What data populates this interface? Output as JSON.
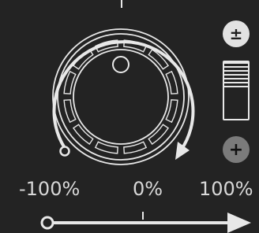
{
  "knob": {
    "value_percent": 0
  },
  "range_labels": {
    "min": "-100%",
    "mid": "0%",
    "max": "100%"
  },
  "side_controls": {
    "invert_button": "±",
    "add_button": "+",
    "fader_level": 0.45
  },
  "colors": {
    "background": "#232323",
    "stroke": "#e8e8e8",
    "text": "#d8d8d8",
    "button_active": "#e2e2e2",
    "button_inactive": "#7b7b7b"
  }
}
